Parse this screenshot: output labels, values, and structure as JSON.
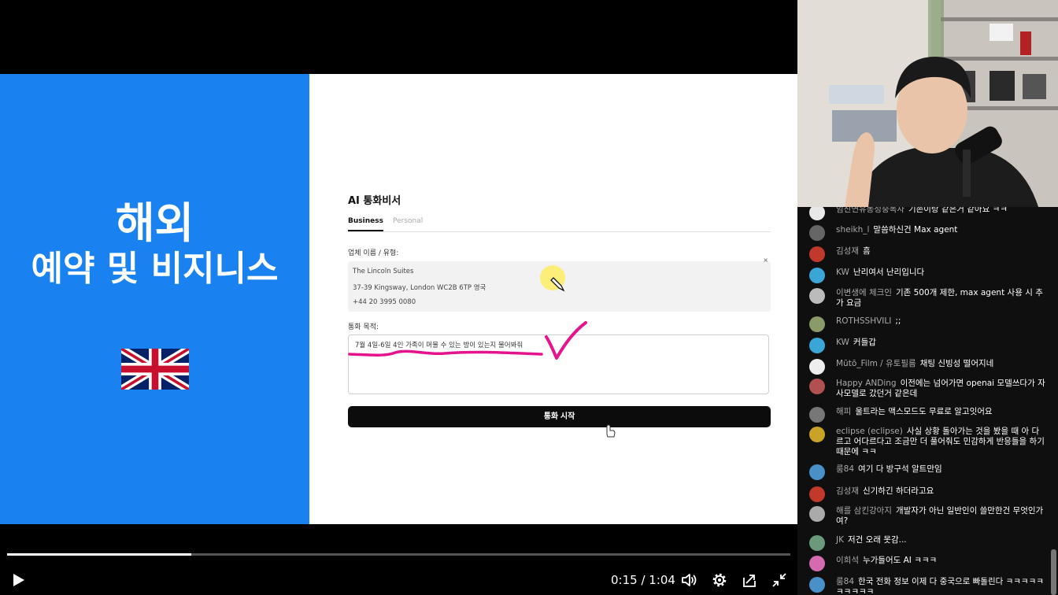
{
  "slide": {
    "title_line1": "해외",
    "title_line2": "예약 및 비지니스"
  },
  "form": {
    "title": "AI 통화비서",
    "tabs": [
      "Business",
      "Personal"
    ],
    "business_label": "업체 이름 / 유형:",
    "business_lines": [
      "The Lincoln Suites",
      "37-39 Kingsway, London WC2B 6TP 영국",
      "+44 20 3995 0080"
    ],
    "close_symbol": "×",
    "purpose_label": "통화 목적:",
    "purpose_text": "7월 4일-6일 4인 가족이 머물 수 있는 방이 있는지 물어봐줘",
    "start_button": "통화 시작"
  },
  "player": {
    "time": "0:15 / 1:04",
    "progress": 0.235,
    "icons": [
      "play-icon",
      "volume-icon",
      "settings-icon",
      "share-icon",
      "exit-fullscreen-icon"
    ]
  },
  "chat": {
    "messages": [
      {
        "author": "임진연유동성중독자",
        "text": "기존이랑 같은거 같아요 ㅋㅋ",
        "color": "#e8e8e8"
      },
      {
        "author": "sheikh_l",
        "text": "말씀하신건 Max agent",
        "color": "#666666"
      },
      {
        "author": "김성재",
        "text": "흠",
        "color": "#c0392b"
      },
      {
        "author": "KW",
        "text": "난리여서 난리입니다",
        "color": "#3aa6d8"
      },
      {
        "author": "이변생에 체크인",
        "text": "기존 500개 제한, max agent 사용 시 추가 요금",
        "color": "#bbbbbb"
      },
      {
        "author": "ROTHSSHVILI",
        "text": ";;",
        "color": "#8a9a6a"
      },
      {
        "author": "KW",
        "text": "커들갑",
        "color": "#3aa6d8"
      },
      {
        "author": "Mūtō_Film / 유토필름",
        "text": "채팅 신빙성 떨어지네",
        "color": "#eeeeee"
      },
      {
        "author": "Happy ANDing",
        "text": "이전에는 넘어가면 openai 모델쓰다가 자사모델로 갔던거 같은데",
        "color": "#b05050"
      },
      {
        "author": "해피",
        "text": "울트라는 맥스모드도 무료로 알고잇어요",
        "color": "#777777"
      },
      {
        "author": "eclipse (eclipse)",
        "text": "사실 상황 돌아가는 것을 봤을 때 아 다르고 어다르다고 조금만 더 풀어줘도 민감하게 반응들을 하기 때문에 ㅋㅋ",
        "color": "#c9a227"
      },
      {
        "author": "룸84",
        "text": "여기 다 방구석 알트만임",
        "color": "#4a90c8"
      },
      {
        "author": "김성재",
        "text": "신기하긴 하더라고요",
        "color": "#c0392b"
      },
      {
        "author": "해를 삼킨강아지",
        "text": "개발자가 아닌 일반인이 쓸만한건 무엇인가여?",
        "color": "#aaaaaa"
      },
      {
        "author": "JK",
        "text": "저건 오래 못감...",
        "color": "#6a9a7a"
      },
      {
        "author": "이희석",
        "text": "누가들어도 AI ㅋㅋㅋ",
        "color": "#d46ab0"
      },
      {
        "author": "룸84",
        "text": "한국 전화 정보 이제 다 중국으로 빠돌린다 ㅋㅋㅋㅋㅋㅋㅋㅋㅋㅋ",
        "color": "#4a90c8"
      }
    ]
  },
  "colors": {
    "slide_blue": "#1a82f0",
    "annotation_pink": "#e6138f",
    "chat_bg": "#0f0f0f"
  }
}
